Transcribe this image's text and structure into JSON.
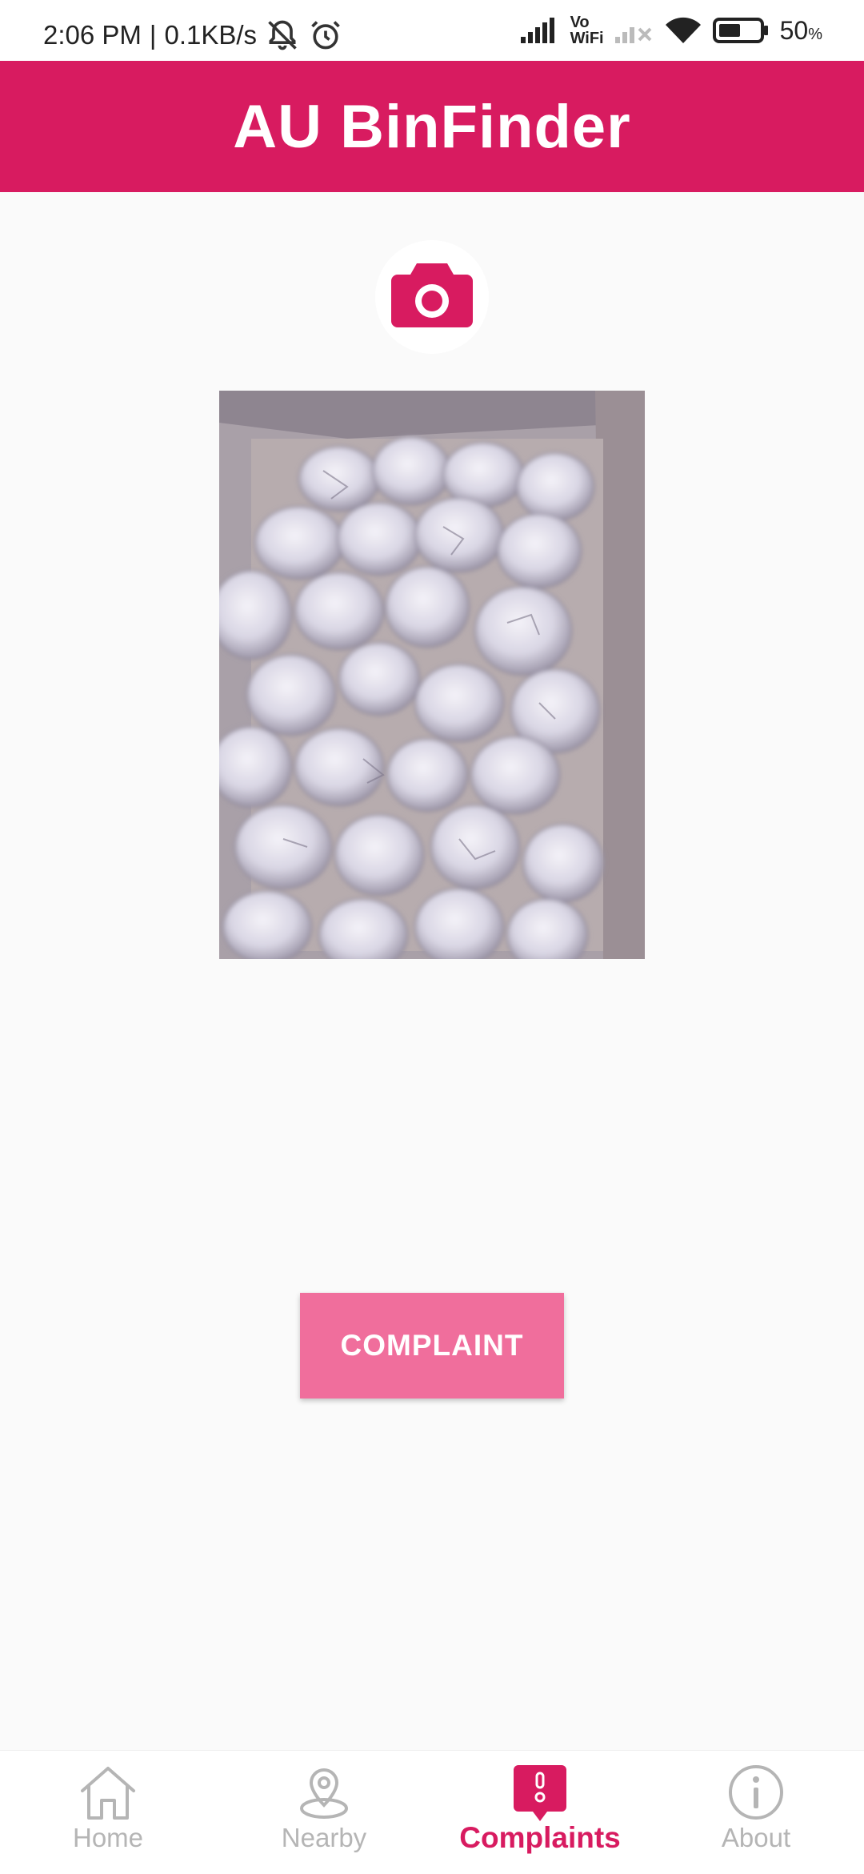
{
  "status_bar": {
    "time": "2:06 PM",
    "separator": "|",
    "speed": "0.1KB/s",
    "vowifi_top": "Vo",
    "vowifi_bottom": "WiFi",
    "battery": "50",
    "battery_unit": "%"
  },
  "app_bar": {
    "title": "AU BinFinder"
  },
  "main": {
    "camera_icon": "camera-icon",
    "complaint_button": "COMPLAINT"
  },
  "bottom_nav": {
    "items": [
      {
        "label": "Home",
        "icon": "home-icon",
        "active": false
      },
      {
        "label": "Nearby",
        "icon": "location-pin-icon",
        "active": false
      },
      {
        "label": "Complaints",
        "icon": "complaint-bubble-icon",
        "active": true
      },
      {
        "label": "About",
        "icon": "info-icon",
        "active": false
      }
    ]
  },
  "colors": {
    "primary": "#d81b60",
    "button": "#f06e9c",
    "inactive": "#b5b5b5",
    "background": "#fafafa"
  }
}
